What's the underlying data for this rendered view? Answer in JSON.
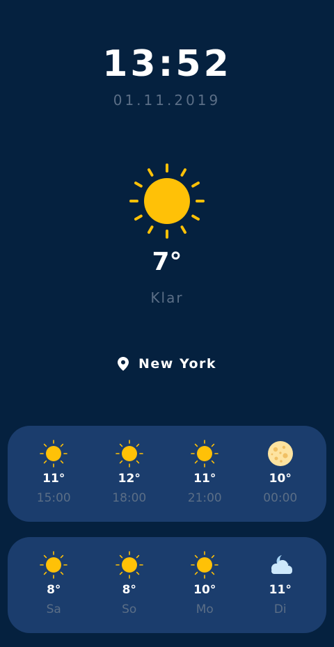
{
  "clock": {
    "time": "13:52",
    "date": "01.11.2019"
  },
  "current": {
    "temperature": "7°",
    "condition": "Klar",
    "icon": "sun-icon"
  },
  "location": {
    "name": "New York",
    "icon": "location-pin-icon"
  },
  "hourly": [
    {
      "time": "15:00",
      "temp": "11°",
      "icon": "sun-icon"
    },
    {
      "time": "18:00",
      "temp": "12°",
      "icon": "sun-icon"
    },
    {
      "time": "21:00",
      "temp": "11°",
      "icon": "sun-icon"
    },
    {
      "time": "00:00",
      "temp": "10°",
      "icon": "moon-icon"
    }
  ],
  "daily": [
    {
      "day": "Sa",
      "temp": "8°",
      "icon": "sun-icon"
    },
    {
      "day": "So",
      "temp": "8°",
      "icon": "sun-icon"
    },
    {
      "day": "Mo",
      "temp": "10°",
      "icon": "sun-icon"
    },
    {
      "day": "Di",
      "temp": "11°",
      "icon": "cloudy-night-icon"
    }
  ],
  "colors": {
    "background": "#05213f",
    "card": "#1b3d6d",
    "muted_text": "#5b6e86",
    "sun": "#ffc107"
  }
}
